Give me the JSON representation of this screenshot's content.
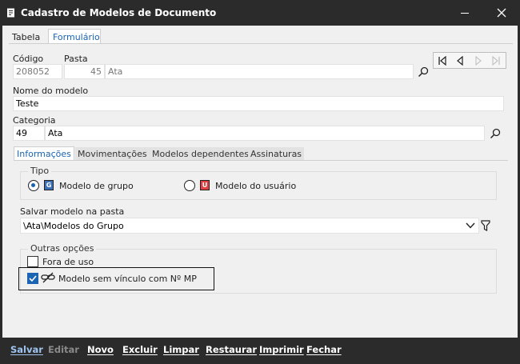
{
  "window": {
    "title": "Cadastro de Modelos de Documento"
  },
  "top_tabs": [
    {
      "label": "Tabela"
    },
    {
      "label": "Formulário"
    }
  ],
  "form": {
    "codigo_label": "Código",
    "codigo_value": "208052",
    "pasta_label": "Pasta",
    "pasta_code": "45",
    "pasta_name": "Ata",
    "nome_label": "Nome do modelo",
    "nome_value": "Teste",
    "categoria_label": "Categoria",
    "categoria_code": "49",
    "categoria_name": "Ata"
  },
  "sub_tabs": [
    {
      "label": "Informações"
    },
    {
      "label": "Movimentações"
    },
    {
      "label": "Modelos dependentes"
    },
    {
      "label": "Assinaturas"
    }
  ],
  "tipo": {
    "title": "Tipo",
    "options": [
      {
        "label": "Modelo de grupo",
        "badge": "G",
        "selected": true
      },
      {
        "label": "Modelo do usuário",
        "badge": "U",
        "selected": false
      }
    ]
  },
  "salvar": {
    "label": "Salvar modelo na pasta",
    "value": "\\Ata\\Modelos do Grupo"
  },
  "outras": {
    "title": "Outras opções",
    "fora_de_uso": {
      "label": "Fora de uso",
      "checked": false
    },
    "sem_vinculo": {
      "label": "Modelo sem vínculo com Nº MP",
      "checked": true
    }
  },
  "footer": {
    "buttons": [
      {
        "label": "Salvar"
      },
      {
        "label": "Editar"
      },
      {
        "label": "Novo"
      },
      {
        "label": "Excluir"
      },
      {
        "label": "Limpar"
      },
      {
        "label": "Restaurar"
      },
      {
        "label": "Imprimir"
      },
      {
        "label": "Fechar"
      }
    ]
  },
  "colors": {
    "accent": "#1a64b3",
    "titlebar": "#2b2b2b",
    "client_bg": "#f0f0f0",
    "badge_g": "#3b6fb6",
    "badge_u": "#e34141"
  }
}
